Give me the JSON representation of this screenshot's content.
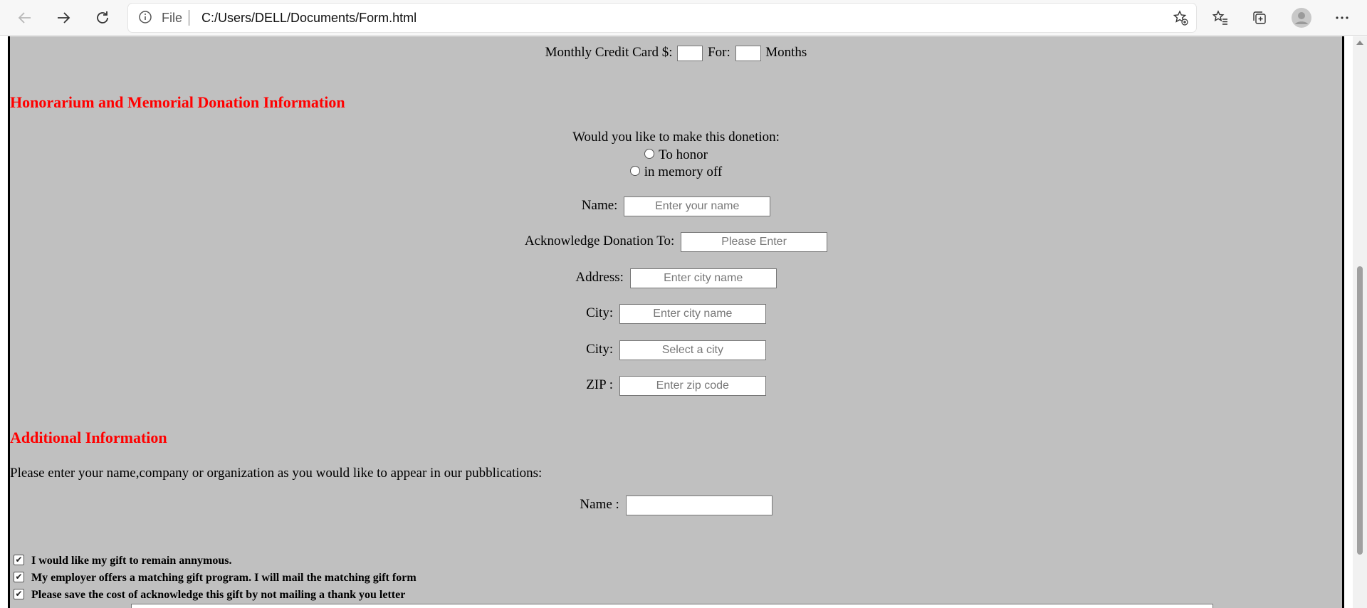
{
  "browser": {
    "file_label": "File",
    "url": "C:/Users/DELL/Documents/Form.html"
  },
  "icons": {
    "back": "back-arrow-icon",
    "forward": "forward-arrow-icon",
    "refresh": "refresh-icon",
    "info": "info-icon",
    "add_favorite": "star-plus-icon",
    "favorites": "favorites-icon",
    "collections": "collections-icon",
    "profile": "profile-icon",
    "menu": "more-icon"
  },
  "form": {
    "monthly": {
      "label": "Monthly Credit Card $:",
      "for_label": "For:",
      "months_label": "Months"
    },
    "honorarium": {
      "heading": "Honorarium and Memorial Donation Information",
      "question": "Would you like to make this donetion:",
      "option_honor": "To honor",
      "option_memory": "in memory off",
      "name_label": "Name:",
      "name_placeholder": "Enter your name",
      "acknowledge_label": "Acknowledge Donation To:",
      "acknowledge_placeholder": "Please Enter",
      "address_label": "Address:",
      "address_placeholder": "Enter city name",
      "city_label": "City:",
      "city_placeholder": "Enter city name",
      "city2_label": "City:",
      "city2_placeholder": "Select a city",
      "zip_label": "ZIP :",
      "zip_placeholder": "Enter zip code"
    },
    "additional": {
      "heading": "Additional Information",
      "instruction": "Please enter your name,company or organization as you would like to appear in our pubblications:",
      "name_label": "Name :",
      "name_value": "",
      "checkboxes": [
        {
          "label": "I would like my gift to remain annymous.",
          "checked": true
        },
        {
          "label": "My employer offers a matching gift program. I will mail the matching gift form",
          "checked": true
        },
        {
          "label": "Please save the cost of acknowledge this gift by not mailing a thank you letter",
          "checked": true
        }
      ]
    }
  },
  "colors": {
    "page_background": "#c0c0c0",
    "heading": "#ff0000"
  }
}
